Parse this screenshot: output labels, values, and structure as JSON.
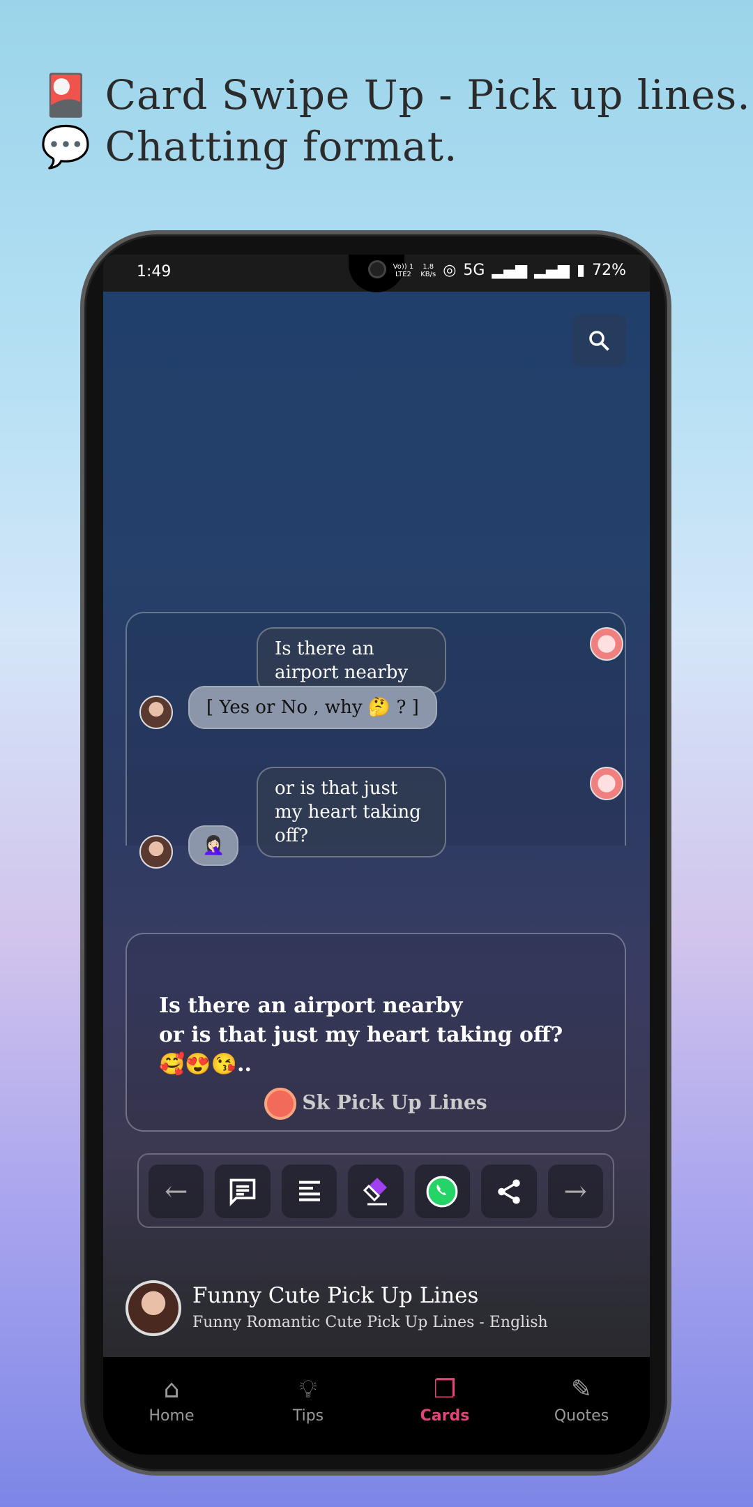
{
  "headline": {
    "line1_icon": "card-icon",
    "line1": "Card Swipe Up  - Pick up lines.",
    "line2_icon": "speech-bubble-icon",
    "line2": "Chatting format."
  },
  "status": {
    "time": "1:49",
    "volte": "Vo)) 1",
    "lte": "LTE2",
    "speed": "1.8",
    "speed_unit": "KB/s",
    "network": "5G",
    "battery": "72%"
  },
  "chat": [
    {
      "side": "sent",
      "text": "Is there an airport nearby"
    },
    {
      "side": "received",
      "text": "[ Yes or No , why 🤔 ? ]"
    },
    {
      "side": "sent",
      "text": "or is that just my heart taking off?"
    },
    {
      "side": "received",
      "text": "🤦🏻‍♀️"
    }
  ],
  "quote": {
    "line1": "Is there an airport nearby",
    "line2": "or is that just my heart taking off?",
    "emojis": "🥰😍😘..",
    "brand": "Sk Pick Up Lines"
  },
  "toolbar": [
    "arrow-left-icon",
    "chat-icon",
    "align-left-icon",
    "eraser-icon",
    "whatsapp-icon",
    "share-icon",
    "arrow-right-icon"
  ],
  "app": {
    "title": "Funny Cute Pick Up Lines",
    "subtitle": "Funny Romantic Cute Pick Up Lines - English"
  },
  "nav": [
    {
      "label": "Home",
      "icon": "home-icon"
    },
    {
      "label": "Tips",
      "icon": "lightbulb-icon"
    },
    {
      "label": "Cards",
      "icon": "cards-icon",
      "active": true
    },
    {
      "label": "Quotes",
      "icon": "pencil-icon"
    }
  ],
  "colors": {
    "accent": "#e0457a",
    "whatsapp": "#25d366"
  }
}
